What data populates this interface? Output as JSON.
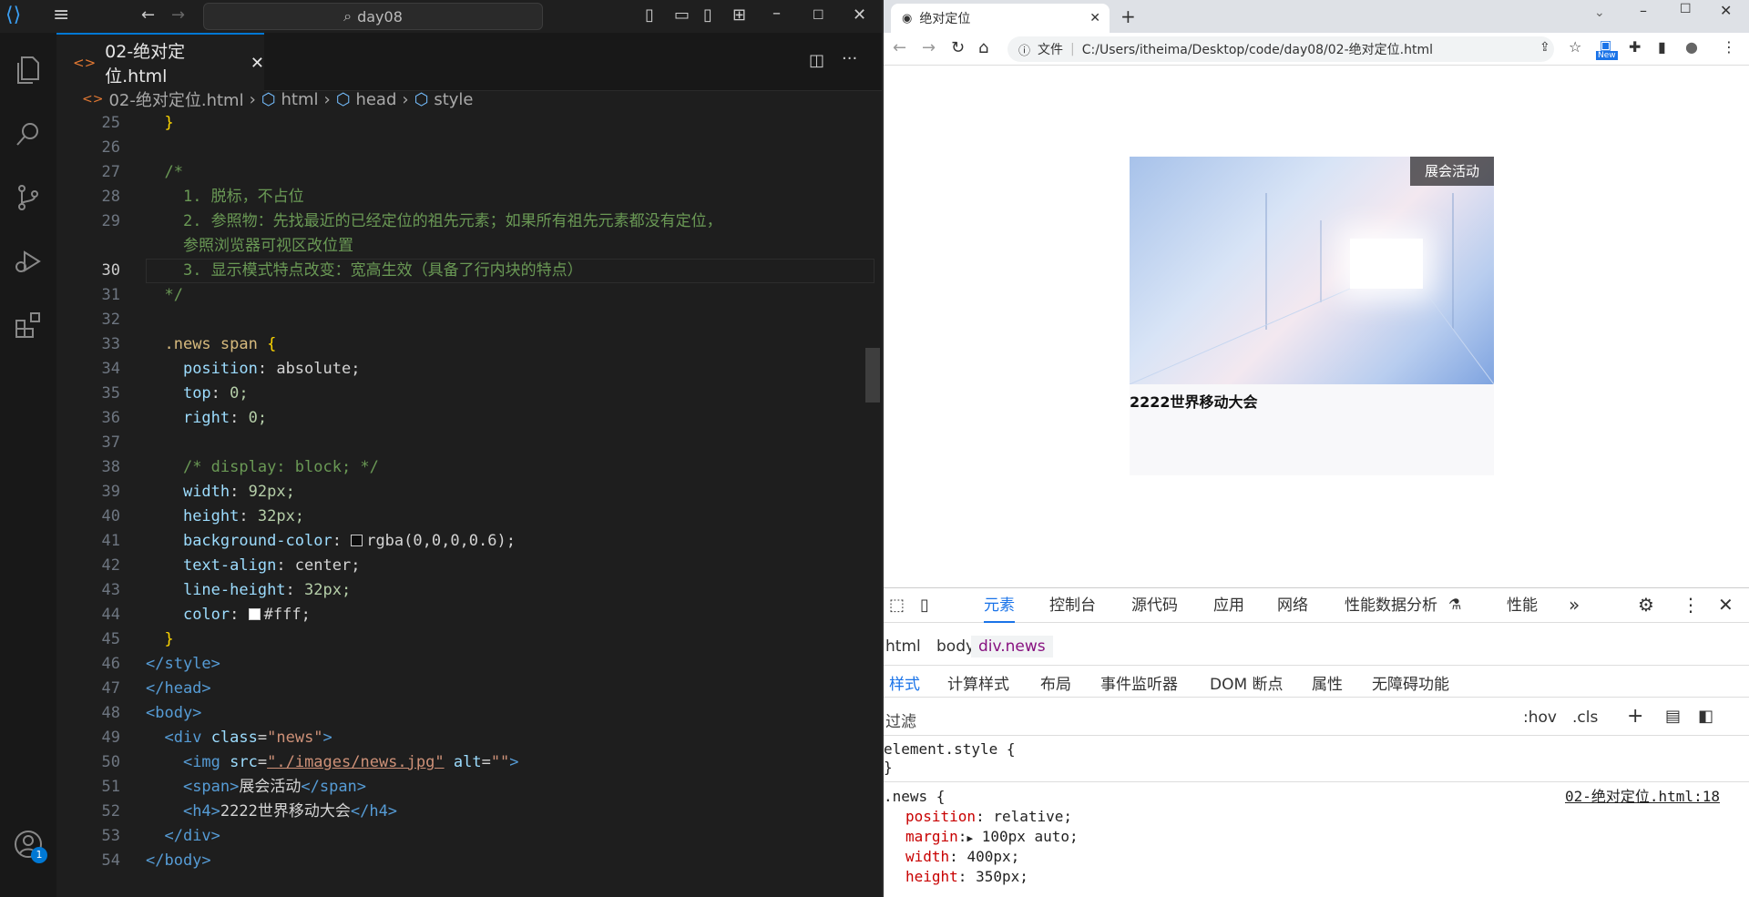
{
  "vscode": {
    "search_text": "day08",
    "tab_label": "02-绝对定位.html",
    "breadcrumb": [
      "02-绝对定位.html",
      "html",
      "head",
      "style"
    ],
    "notification_count": "1",
    "lines": [
      {
        "n": "25",
        "cur": false
      },
      {
        "n": "26",
        "cur": false
      },
      {
        "n": "27",
        "cur": false
      },
      {
        "n": "28",
        "cur": false
      },
      {
        "n": "29",
        "cur": false
      },
      {
        "n": "",
        "cur": false
      },
      {
        "n": "30",
        "cur": true
      },
      {
        "n": "31",
        "cur": false
      },
      {
        "n": "32",
        "cur": false
      },
      {
        "n": "33",
        "cur": false
      },
      {
        "n": "34",
        "cur": false
      },
      {
        "n": "35",
        "cur": false
      },
      {
        "n": "36",
        "cur": false
      },
      {
        "n": "37",
        "cur": false
      },
      {
        "n": "38",
        "cur": false
      },
      {
        "n": "39",
        "cur": false
      },
      {
        "n": "40",
        "cur": false
      },
      {
        "n": "41",
        "cur": false
      },
      {
        "n": "42",
        "cur": false
      },
      {
        "n": "43",
        "cur": false
      },
      {
        "n": "44",
        "cur": false
      },
      {
        "n": "45",
        "cur": false
      },
      {
        "n": "46",
        "cur": false
      },
      {
        "n": "47",
        "cur": false
      },
      {
        "n": "48",
        "cur": false
      },
      {
        "n": "49",
        "cur": false
      },
      {
        "n": "50",
        "cur": false
      },
      {
        "n": "51",
        "cur": false
      },
      {
        "n": "52",
        "cur": false
      },
      {
        "n": "53",
        "cur": false
      },
      {
        "n": "54",
        "cur": false
      }
    ],
    "code": {
      "l25": "}",
      "l27": "/*",
      "l28": "1. 脱标，不占位",
      "l29": "2. 参照物：先找最近的已经定位的祖先元素；如果所有祖先元素都没有定位，",
      "l29b": "参照浏览器可视区改位置",
      "l30": "3. 显示模式特点改变：宽高生效（具备了行内块的特点）",
      "l31": "*/",
      "l33_sel": ".news span",
      "l33_br": "{",
      "l34_p": "position",
      "l34_v": "absolute;",
      "l35_p": "top",
      "l35_v": "0;",
      "l36_p": "right",
      "l36_v": "0;",
      "l38": "/* display: block; */",
      "l39_p": "width",
      "l39_v": "92px;",
      "l40_p": "height",
      "l40_v": "32px;",
      "l41_p": "background-color",
      "l41_v": "rgba(0,0,0,0.6);",
      "l42_p": "text-align",
      "l42_v": "center;",
      "l43_p": "line-height",
      "l43_v": "32px;",
      "l44_p": "color",
      "l44_v": "#fff;",
      "l45": "}",
      "l46": "</style>",
      "l47": "</head>",
      "l48": "<body>",
      "l49_tag": "<div",
      "l49_attr": "class",
      "l49_val": "\"news\"",
      "l49_end": ">",
      "l50_tag": "<img",
      "l50_src": "src",
      "l50_srcv": "\"./images/news.jpg\"",
      "l50_alt": "alt",
      "l50_altv": "\"\"",
      "l50_end": ">",
      "l51_open": "<span>",
      "l51_text": "展会活动",
      "l51_close": "</span>",
      "l52_open": "<h4>",
      "l52_text": "2222世界移动大会",
      "l52_close": "</h4>",
      "l53": "</div>",
      "l54": "</body>"
    }
  },
  "chrome": {
    "tab_title": "绝对定位",
    "addr_label": "文件",
    "url": "C:/Users/itheima/Desktop/code/day08/02-绝对定位.html",
    "new_badge": "New",
    "page": {
      "badge": "展会活动",
      "heading": "2222世界移动大会"
    },
    "devtools": {
      "tabs": [
        "元素",
        "控制台",
        "源代码",
        "应用",
        "网络",
        "性能数据分析",
        "性能"
      ],
      "crumbs": [
        "html",
        "body",
        "div.news"
      ],
      "subtabs": [
        "样式",
        "计算样式",
        "布局",
        "事件监听器",
        "DOM 断点",
        "属性",
        "无障碍功能"
      ],
      "filter": "过滤",
      "hov": ":hov",
      "cls": ".cls",
      "rule1": "element.style {",
      "rule1_end": "}",
      "rule2": ".news {",
      "rule2_src": "02-绝对定位.html:18",
      "props": [
        {
          "p": "position",
          "v": "relative;"
        },
        {
          "p": "margin",
          "v": "100px auto;"
        },
        {
          "p": "width",
          "v": "400px;"
        },
        {
          "p": "height",
          "v": "350px;"
        }
      ]
    }
  }
}
